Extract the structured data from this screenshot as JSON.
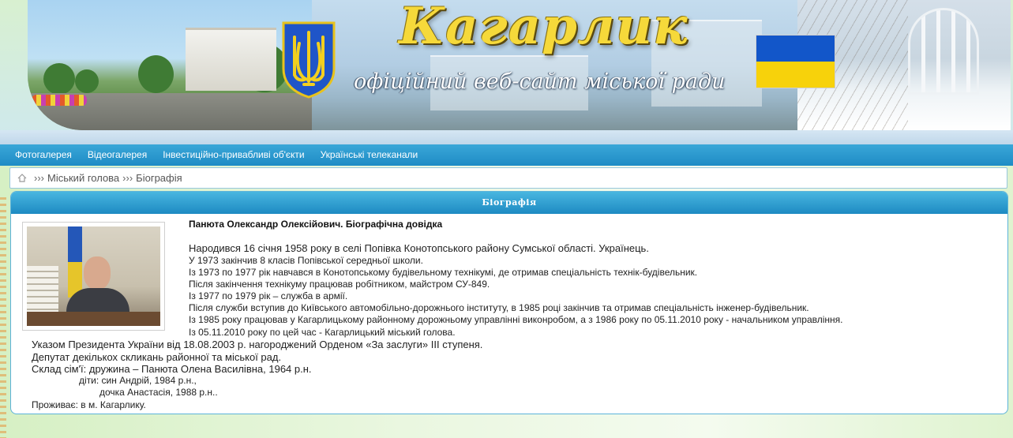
{
  "header": {
    "title": "Кагарлик",
    "subtitle": "офіційний веб-сайт міської ради"
  },
  "nav": {
    "items": [
      {
        "label": "Фотогалерея"
      },
      {
        "label": "Відеогалерея"
      },
      {
        "label": "Інвестиційно-привабливі об'єкти"
      },
      {
        "label": "Українські телеканали"
      }
    ]
  },
  "breadcrumb": {
    "sep": "›››",
    "items": [
      "Міський голова",
      "Біографія"
    ]
  },
  "panel": {
    "heading": "Біографія",
    "doc_title": "Панюта Олександр Олексійович. Біографічна довідка",
    "lead": "Народився 16 січня 1958 року в селі Попівка Конотопського району Сумської області. Українець.",
    "lines": [
      "У 1973 закінчив 8 класів Попівської середньої школи.",
      "Із 1973 по 1977 рік навчався в Конотопському будівельному технікумі, де отримав спеціальність технік-будівельник.",
      "Після закінчення технікуму працював робітником, майстром СУ-849.",
      "Із 1977 по 1979 рік – служба в армії.",
      "Після служби вступив до Київського автомобільно-дорожнього інституту, в 1985 році закінчив та отримав спеціальність інженер-будівельник.",
      "Із 1985 року працював у Кагарлицькому районному дорожньому управлінні виконробом, а з 1986 року по 05.11.2010 року  - начальником управління.",
      "Із 05.11.2010 року по цей час - Кагарлицький міський голова."
    ],
    "bottom_lines": [
      "Указом Президента України від 18.08.2003 р. нагороджений Орденом «За заслуги» ІІІ ступеня.",
      "Депутат декількох скликань районної та міської рад.",
      "Склад сім'ї: дружина – Панюта Олена Василівна, 1964 р.н."
    ],
    "children": [
      "діти: син Андрій, 1984 р.н.,",
      "дочка Анастасія, 1988 р.н.."
    ],
    "residence": "Проживає: в  м. Кагарлику."
  },
  "colors": {
    "nav": "#1e8cc5",
    "panel_border": "#5cb3d9",
    "title_yellow": "#f6d93a",
    "flag_blue": "#1256c9",
    "flag_yellow": "#f7d20b"
  },
  "icons": {
    "home": "home-icon",
    "coat_of_arms": "trident-coat-of-arms",
    "flag": "ukraine-flag"
  }
}
